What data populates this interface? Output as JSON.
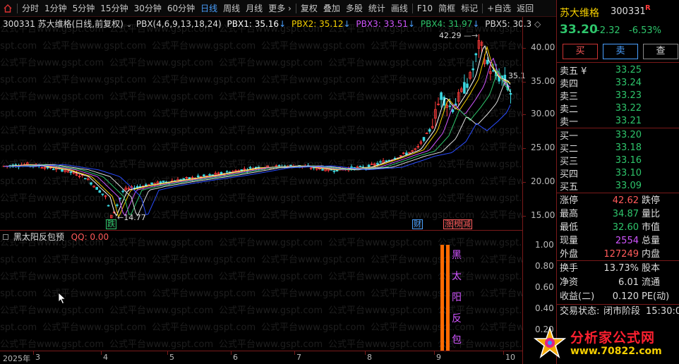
{
  "toolbar": {
    "items": [
      "分时",
      "1分钟",
      "5分钟",
      "15分钟",
      "30分钟",
      "60分钟",
      "日线",
      "周线",
      "月线",
      "更多 ›",
      "复权",
      "叠加",
      "多股",
      "统计",
      "画线",
      "F10",
      "简框",
      "标记",
      "+自选",
      "返回"
    ],
    "active": "日线"
  },
  "main_chart": {
    "legend": {
      "title": "300331 苏大维格(日线,前复权)",
      "indicator": "PBX(4,6,9,13,18,24)",
      "pbx1": "PBX1: 35.16",
      "pbx2": "PBX2: 35.12",
      "pbx3": "PBX3: 33.51",
      "pbx4": "PBX4: 31.97",
      "pbx5": "PBX5: 30.3"
    },
    "price_axis": [
      "40.00",
      "35.00",
      "30.00",
      "25.00",
      "20.00",
      "15.00"
    ],
    "annotations": {
      "high": "42.29",
      "low": "14.77",
      "last": "35.1"
    },
    "markers": [
      {
        "text": "跌",
        "color": "#2ec56b"
      },
      {
        "text": "财",
        "color": "#4aa0ff"
      },
      {
        "text": "涨",
        "color": "#ff5a5a"
      },
      {
        "text": "榜",
        "color": "#ff5a5a"
      },
      {
        "text": "减",
        "color": "#ff5a5a"
      }
    ],
    "watermark": "公式平台www.gspt.com"
  },
  "sub_chart": {
    "title": "黑太阳反包预",
    "qq_label": "QQ: 0.00",
    "axis": [
      "1.00",
      "0.80",
      "0.60",
      "0.40",
      "0.20"
    ],
    "signal_chars": [
      "黑",
      "太",
      "阳",
      "反",
      "包"
    ]
  },
  "date_axis": [
    "2025年",
    "3",
    "4",
    "5",
    "6",
    "7",
    "8",
    "9",
    "10"
  ],
  "right_panel": {
    "name": "苏大维格",
    "code": "300331",
    "flag": "R",
    "price": "33.20",
    "change": "-2.32",
    "change_pct": "-6.53%",
    "buttons": [
      "买",
      "卖",
      "查"
    ],
    "sell": [
      {
        "label": "卖五 ¥",
        "price": "33.25"
      },
      {
        "label": "卖四",
        "price": "33.24"
      },
      {
        "label": "卖三",
        "price": "33.23"
      },
      {
        "label": "卖二",
        "price": "33.22"
      },
      {
        "label": "卖一",
        "price": "33.21"
      }
    ],
    "buy": [
      {
        "label": "买一",
        "price": "33.20"
      },
      {
        "label": "买二",
        "price": "33.18"
      },
      {
        "label": "买三",
        "price": "33.16"
      },
      {
        "label": "买四",
        "price": "33.10"
      },
      {
        "label": "买五",
        "price": "33.09"
      }
    ],
    "stats": [
      {
        "label": "涨停",
        "value": "42.62",
        "value_color": "#ff5a5a",
        "label2": "跌停"
      },
      {
        "label": "最高",
        "value": "34.87",
        "value_color": "#2ec56b",
        "label2": "量比"
      },
      {
        "label": "最低",
        "value": "32.60",
        "value_color": "#2ec56b",
        "label2": "市值"
      },
      {
        "label": "现量",
        "value": "2554",
        "value_color": "#d055ff",
        "label2": "总量"
      },
      {
        "label": "外盘",
        "value": "127249",
        "value_color": "#ff5a5a",
        "label2": "内盘"
      }
    ],
    "stats2": [
      {
        "label": "换手",
        "value": "13.73%",
        "label2": "股本"
      },
      {
        "label": "净资",
        "value": "6.01",
        "label2": "流通"
      },
      {
        "label": "收益(二)",
        "value": "0.120",
        "label2": "PE(动)"
      }
    ],
    "trade_status_label": "交易状态:",
    "trade_status": "闭市阶段",
    "trade_time": "15:30:0"
  },
  "logo": {
    "title": "分析家公式网",
    "url": "www.70822.com"
  }
}
